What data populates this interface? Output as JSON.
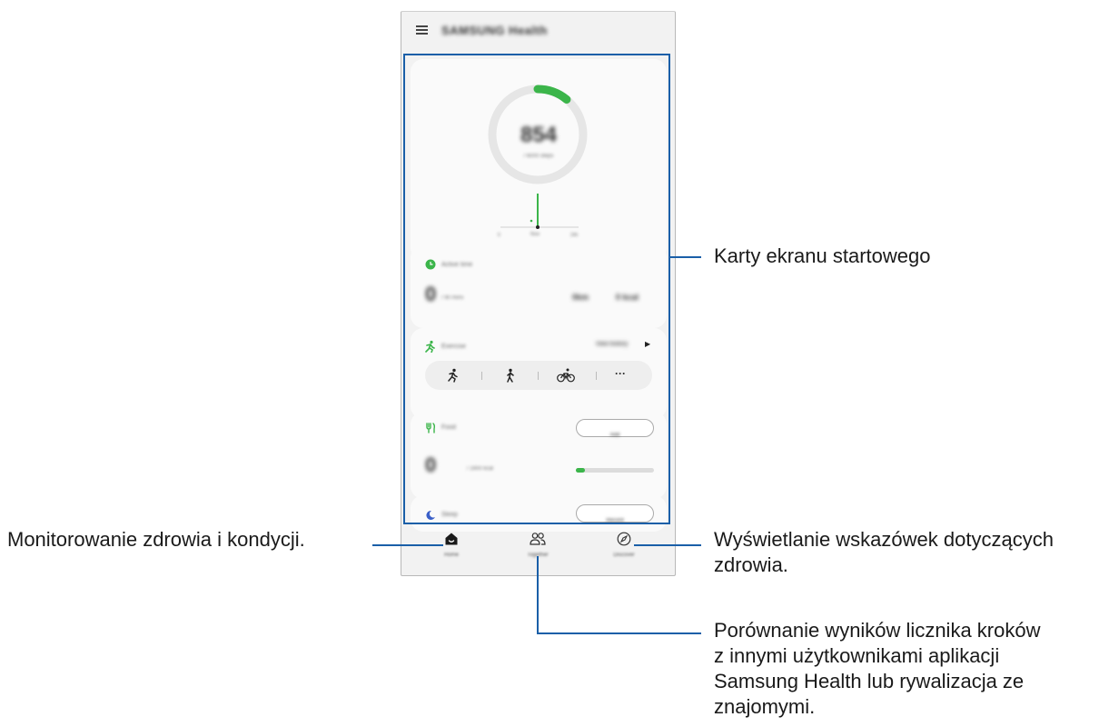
{
  "app": {
    "title": "SAMSUNG Health",
    "steps_card": {
      "step_count": "854",
      "goal": "/ 6000 steps",
      "axis_start": "0",
      "axis_mid": "Now",
      "axis_end": "24h",
      "ring_progress": 0.11,
      "accent": "#3bb54a"
    },
    "active_time": {
      "title": "Active time",
      "value": "0",
      "unit": "/ 90 mins",
      "stat_a": "0km",
      "stat_b": "0 kcal"
    },
    "exercise": {
      "title": "Exercise",
      "view_history": "View history",
      "shortcuts": [
        "running-icon",
        "walking-icon",
        "cycling-icon",
        "more-icon"
      ],
      "more_label": "···"
    },
    "food": {
      "title": "Food",
      "button": "Add",
      "value": "0",
      "unit": "/ 1900 kcal",
      "progress": 0.12
    },
    "sleep": {
      "title": "Sleep",
      "button": "Record"
    },
    "nav": [
      {
        "label": "Home",
        "icon": "home-icon"
      },
      {
        "label": "Together",
        "icon": "people-icon"
      },
      {
        "label": "Discover",
        "icon": "compass-icon"
      }
    ]
  },
  "annotations": {
    "home_cards": "Karty ekranu startowego",
    "home_tab": "Monitorowanie zdrowia i kondycji.",
    "discover_line1": "Wyświetlanie wskazówek dotyczących",
    "discover_line2": "zdrowia.",
    "together_line1": "Porównanie wyników licznika kroków",
    "together_line2": "z innymi użytkownikami aplikacji",
    "together_line3": "Samsung Health lub rywalizacja ze",
    "together_line4": "znajomymi."
  }
}
